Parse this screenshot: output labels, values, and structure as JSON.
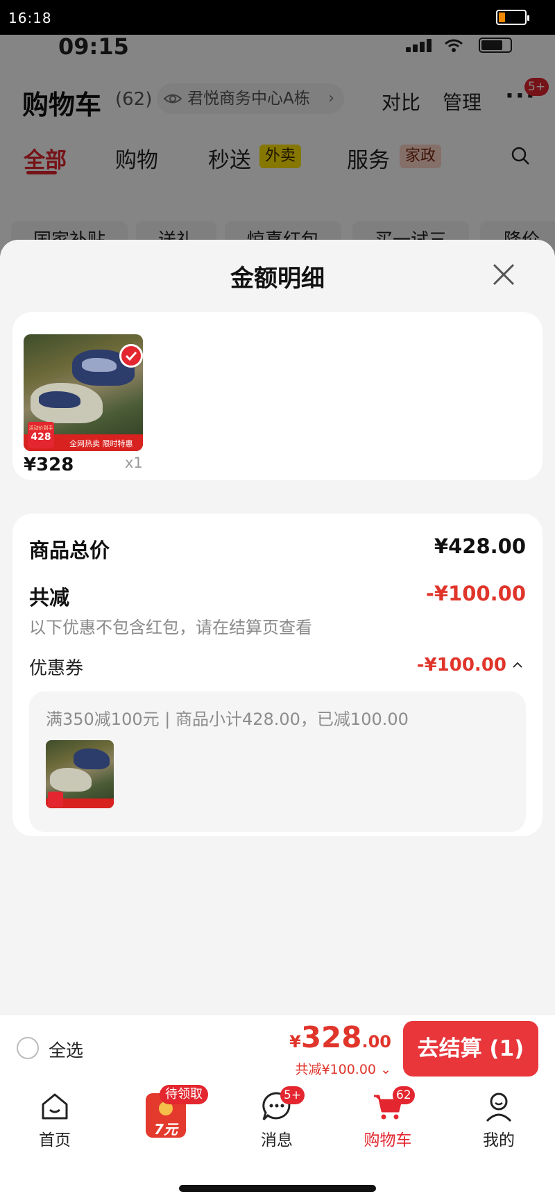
{
  "system_status": {
    "time": "16:18",
    "battery_level": 0.25,
    "battery_color": "#f08a00"
  },
  "background_page": {
    "status_time": "09:15",
    "title": "购物车",
    "count": "(62)",
    "address": "君悦商务中心A栋",
    "actions": [
      "对比",
      "管理"
    ],
    "more_badge": "5+",
    "tabs": [
      {
        "label": "全部",
        "active": true
      },
      {
        "label": "购物",
        "active": false
      },
      {
        "label": "秒送",
        "tag": "外卖",
        "active": false
      },
      {
        "label": "服务",
        "tag": "家政",
        "active": false
      }
    ],
    "filters": [
      "国家补贴",
      "送礼",
      "惊喜红包",
      "买一试三",
      "降价"
    ]
  },
  "sheet": {
    "title": "金额明细",
    "product": {
      "price": "¥328",
      "qty": "x1",
      "promo_price": "428",
      "promo_small": "活动价到手",
      "promo_text": "全网热卖 限时特惠"
    },
    "summary": {
      "total_label": "商品总价",
      "total_value": "¥428.00",
      "discount_label": "共减",
      "discount_value": "-¥100.00",
      "note": "以下优惠不包含红包，请在结算页查看",
      "coupon_label": "优惠券",
      "coupon_value": "-¥100.00",
      "coupon_desc": "满350减100元 | 商品小计428.00，已减100.00"
    }
  },
  "checkout": {
    "select_all": "全选",
    "currency": "¥",
    "total_int": "328",
    "total_dec": ".00",
    "saved": "共减¥100.00",
    "pay_button": "去结算 (1)"
  },
  "tabbar": {
    "items": [
      {
        "label": "首页",
        "icon": "home-icon"
      },
      {
        "label": "",
        "icon": "red-packet-icon"
      },
      {
        "label": "消息",
        "icon": "message-icon"
      },
      {
        "label": "购物车",
        "icon": "cart-icon",
        "active": true
      },
      {
        "label": "我的",
        "icon": "profile-icon"
      }
    ],
    "red_packet_badge": "待领取",
    "red_packet_amount": "7元",
    "message_badge": "5+",
    "cart_badge": "62"
  },
  "colors": {
    "accent": "#e3262f",
    "price_red": "#e0352b",
    "tag_yellow": "#ffe400"
  }
}
